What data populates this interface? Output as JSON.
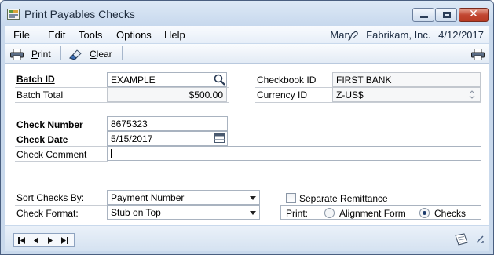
{
  "window": {
    "title": "Print Payables Checks",
    "icons": {
      "app": "app-window-icon",
      "minimize": "minimize-icon",
      "maximize": "maximize-icon",
      "close": "close-icon"
    }
  },
  "menu": {
    "items": [
      "File",
      "Edit",
      "Tools",
      "Options",
      "Help"
    ],
    "user": "Mary2",
    "company": "Fabrikam, Inc.",
    "date": "4/12/2017"
  },
  "toolbar": {
    "print_label": "Print",
    "clear_label": "Clear",
    "icons": {
      "print": "printer-icon",
      "clear": "eraser-icon",
      "print_right": "printer-icon"
    }
  },
  "form": {
    "batch_id_label": "Batch ID",
    "batch_id_value": "EXAMPLE",
    "batch_total_label": "Batch Total",
    "batch_total_value": "$500.00",
    "checkbook_id_label": "Checkbook ID",
    "checkbook_id_value": "FIRST BANK",
    "currency_id_label": "Currency ID",
    "currency_id_value": "Z-US$",
    "check_number_label": "Check Number",
    "check_number_value": "8675323",
    "check_date_label": "Check Date",
    "check_date_value": "5/15/2017",
    "check_comment_label": "Check Comment",
    "check_comment_value": "",
    "sort_checks_label": "Sort Checks By:",
    "sort_checks_value": "Payment Number",
    "check_format_label": "Check Format:",
    "check_format_value": "Stub on Top",
    "separate_remittance_label": "Separate Remittance",
    "separate_remittance_checked": false,
    "print_label": "Print:",
    "print_options": [
      "Alignment Form",
      "Checks"
    ],
    "print_selected": "Checks"
  },
  "colors": {
    "window_bg": "#c9d9ec",
    "accent": "#1b3a6b",
    "close": "#c24732"
  }
}
